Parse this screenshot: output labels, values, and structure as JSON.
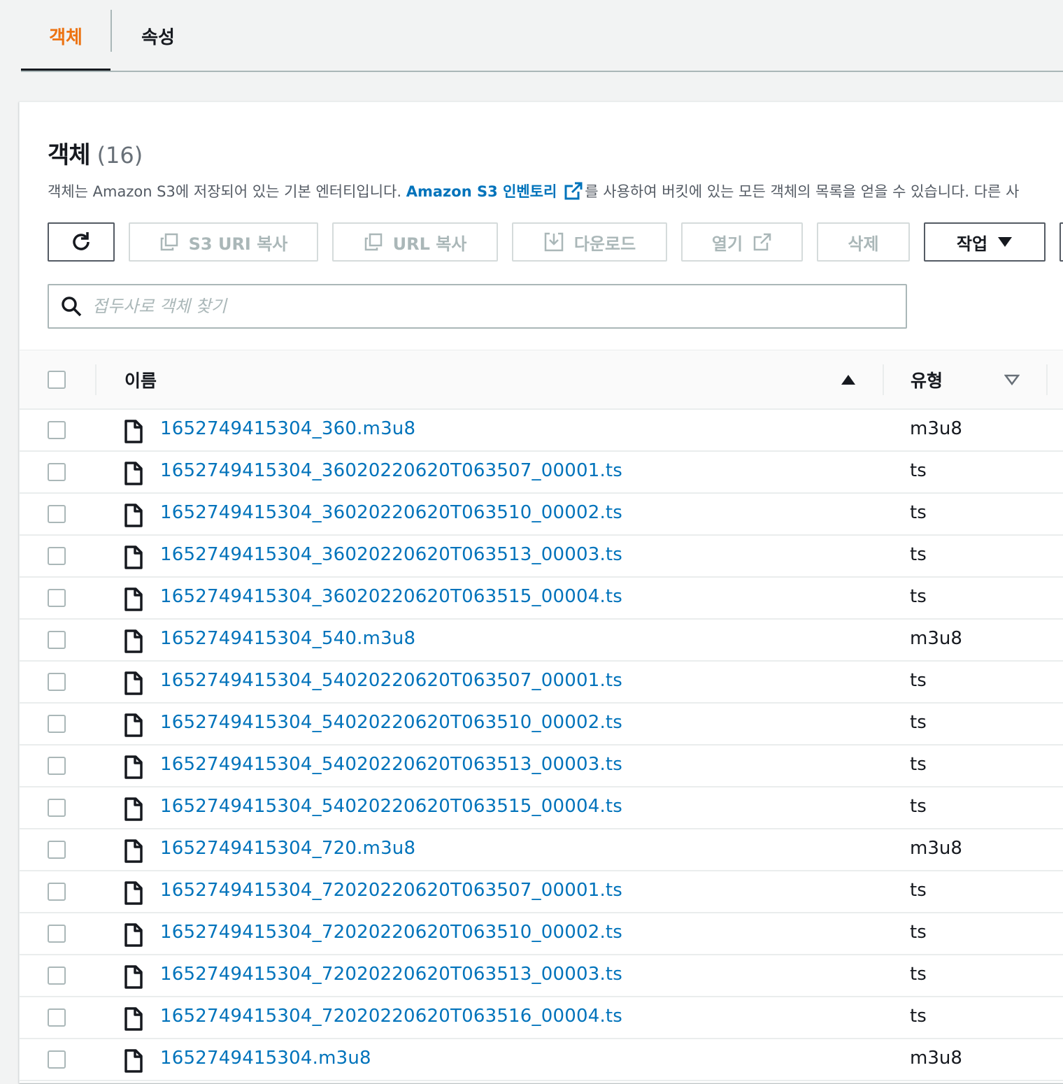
{
  "tabs": [
    {
      "label": "객체",
      "active": true
    },
    {
      "label": "속성",
      "active": false
    }
  ],
  "objects_header": {
    "title": "객체",
    "count": "(16)",
    "description_prefix": "객체는 Amazon S3에 저장되어 있는 기본 엔터티입니다. ",
    "inventory_link": "Amazon S3 인벤토리",
    "description_suffix": "를 사용하여 버킷에 있는 모든 객체의 목록을 얻을 수 있습니다. 다른 사"
  },
  "toolbar": {
    "refresh_icon": "refresh-icon",
    "copy_s3_uri": "S3 URI 복사",
    "copy_url": "URL 복사",
    "download": "다운로드",
    "open": "열기",
    "delete": "삭제",
    "actions": "작업"
  },
  "search": {
    "placeholder": "접두사로 객체 찾기",
    "value": ""
  },
  "table": {
    "columns": [
      "이름",
      "유형"
    ],
    "rows": [
      {
        "name": "1652749415304_360.m3u8",
        "type": "m3u8"
      },
      {
        "name": "1652749415304_36020220620T063507_00001.ts",
        "type": "ts"
      },
      {
        "name": "1652749415304_36020220620T063510_00002.ts",
        "type": "ts"
      },
      {
        "name": "1652749415304_36020220620T063513_00003.ts",
        "type": "ts"
      },
      {
        "name": "1652749415304_36020220620T063515_00004.ts",
        "type": "ts"
      },
      {
        "name": "1652749415304_540.m3u8",
        "type": "m3u8"
      },
      {
        "name": "1652749415304_54020220620T063507_00001.ts",
        "type": "ts"
      },
      {
        "name": "1652749415304_54020220620T063510_00002.ts",
        "type": "ts"
      },
      {
        "name": "1652749415304_54020220620T063513_00003.ts",
        "type": "ts"
      },
      {
        "name": "1652749415304_54020220620T063515_00004.ts",
        "type": "ts"
      },
      {
        "name": "1652749415304_720.m3u8",
        "type": "m3u8"
      },
      {
        "name": "1652749415304_72020220620T063507_00001.ts",
        "type": "ts"
      },
      {
        "name": "1652749415304_72020220620T063510_00002.ts",
        "type": "ts"
      },
      {
        "name": "1652749415304_72020220620T063513_00003.ts",
        "type": "ts"
      },
      {
        "name": "1652749415304_72020220620T063516_00004.ts",
        "type": "ts"
      },
      {
        "name": "1652749415304.m3u8",
        "type": "m3u8"
      }
    ]
  },
  "colors": {
    "accent_orange": "#ec7211",
    "link_blue": "#0073bb",
    "text": "#16191f",
    "disabled": "#aab7b8"
  }
}
